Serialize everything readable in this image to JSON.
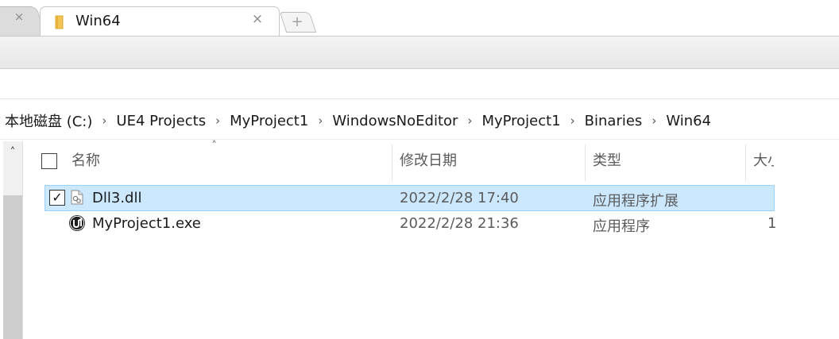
{
  "tabs": {
    "active_title": "Win64",
    "close_symbol": "×",
    "new_tab_symbol": "+"
  },
  "breadcrumb": {
    "items": [
      "本地磁盘 (C:)",
      "UE4 Projects",
      "MyProject1",
      "WindowsNoEditor",
      "MyProject1",
      "Binaries",
      "Win64"
    ],
    "separator": "›"
  },
  "columns": {
    "name": "名称",
    "modified": "修改日期",
    "type": "类型",
    "size": "大小"
  },
  "files": [
    {
      "name": "Dll3.dll",
      "modified": "2022/2/28 17:40",
      "type": "应用程序扩展",
      "size": "",
      "selected": true,
      "checked": true,
      "icon": "dll-file-icon"
    },
    {
      "name": "MyProject1.exe",
      "modified": "2022/2/28 21:36",
      "type": "应用程序",
      "size": "1",
      "selected": false,
      "checked": false,
      "icon": "unreal-engine-icon"
    }
  ],
  "colors": {
    "selection_bg": "#cce8ff",
    "selection_border": "#99d1ff"
  }
}
